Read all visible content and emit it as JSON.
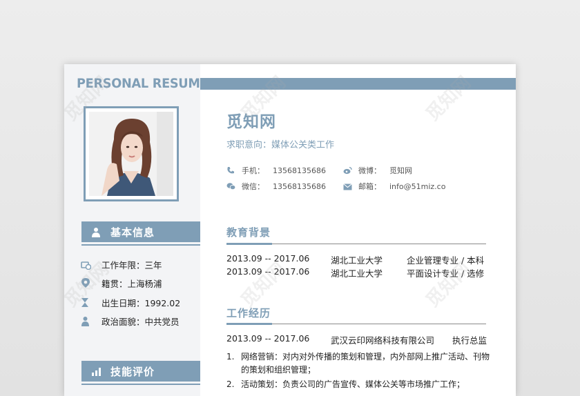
{
  "headline": "PERSONAL RESUME",
  "photo_icon": "portrait-photo",
  "sidebar": {
    "basic_title": "基本信息",
    "basic_items": [
      {
        "icon": "briefcase-clock-icon",
        "text": "工作年限：三年"
      },
      {
        "icon": "location-pin-icon",
        "text": "籍贯：上海杨浦"
      },
      {
        "icon": "hourglass-icon",
        "text": "出生日期：1992.02"
      },
      {
        "icon": "person-icon",
        "text": "政治面貌：中共党员"
      }
    ],
    "skills_title": "技能评价"
  },
  "profile": {
    "name": "觅知网",
    "intent": "求职意向：媒体公关类工作",
    "contacts": [
      {
        "icon": "phone-icon",
        "label": "手机：",
        "value": "13568135686"
      },
      {
        "icon": "weibo-icon",
        "label": "微博：",
        "value": "觅知网"
      },
      {
        "icon": "wechat-icon",
        "label": "微信：",
        "value": "13568135686"
      },
      {
        "icon": "mail-icon",
        "label": "邮箱：",
        "value": "info@51miz.co"
      }
    ]
  },
  "education": {
    "title": "教育背景",
    "rows": [
      {
        "period": "2013.09 -- 2017.06",
        "school": "湖北工业大学",
        "major": "企业管理专业  /  本科"
      },
      {
        "period": "2013.09 -- 2017.06",
        "school": "湖北工业大学",
        "major": "平面设计专业  /  选修"
      }
    ]
  },
  "work": {
    "title": "工作经历",
    "job": {
      "period": "2013.09 -- 2017.06",
      "company": "武汉云印网络科技有限公司",
      "position": "执行总监"
    },
    "duties": [
      {
        "num": "1.",
        "text": "网络营销：对内对外传播的策划和管理，内外部网上推广活动、刊物的策划和组织管理；"
      },
      {
        "num": "2.",
        "text": "活动策划：负责公司的广告宣传、媒体公关等市场推广工作；"
      }
    ]
  },
  "watermark": "觅知网",
  "colors": {
    "accent": "#7f9eb6",
    "sidebar_bg": "#f3f4f6"
  }
}
